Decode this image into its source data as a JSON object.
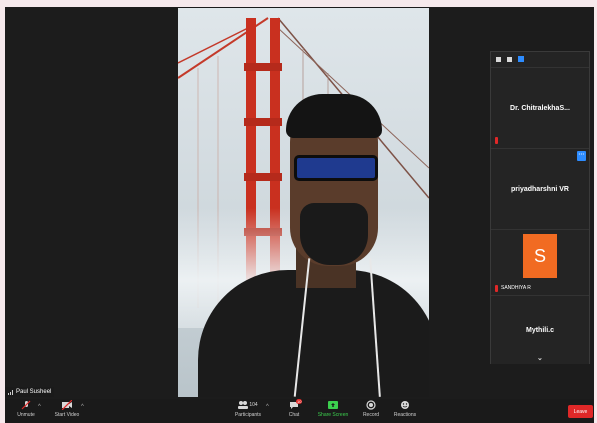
{
  "panel": {
    "participants": [
      {
        "name": "Dr.  ChitralekhaS..."
      },
      {
        "name": "priyadharshni VR",
        "more": "···"
      },
      {
        "initial": "S",
        "name": "SANDHIYA R"
      },
      {
        "name": "Mythili.c"
      }
    ],
    "scroll_down": "⌄"
  },
  "speaker": {
    "name": "Paul Susheel"
  },
  "toolbar": {
    "unmute": "Unmute",
    "start_video": "Start Video",
    "participants": "Participants",
    "participant_count": "104",
    "chat": "Chat",
    "chat_badge": "10",
    "share_screen": "Share Screen",
    "record": "Record",
    "reactions": "Reactions",
    "leave": "Leave"
  },
  "colors": {
    "accent": "#2d8cff",
    "share": "#3ccf4e",
    "danger": "#e02828",
    "avatar": "#f16b22"
  }
}
